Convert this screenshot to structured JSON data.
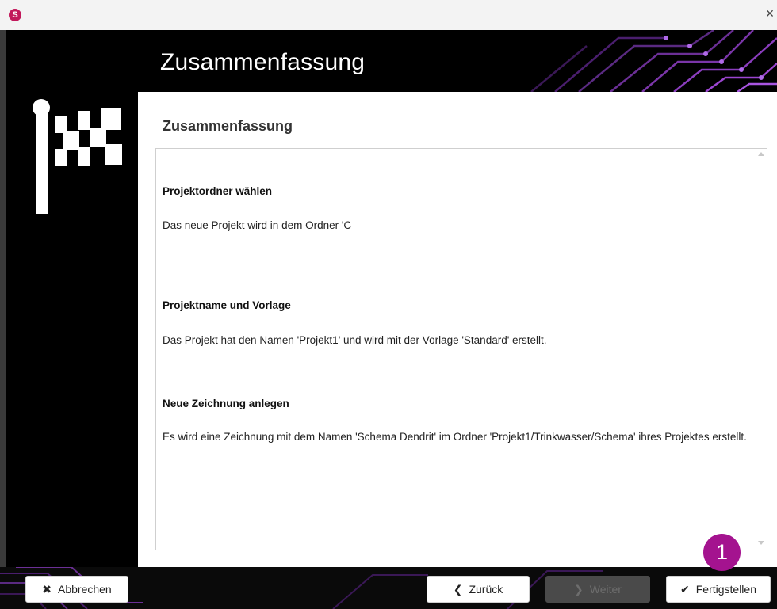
{
  "window": {
    "app_logo_letter": "S",
    "close_glyph": "×"
  },
  "header": {
    "title": "Zusammenfassung"
  },
  "main": {
    "title": "Zusammenfassung",
    "sections": [
      {
        "heading": "Projektordner wählen",
        "text": "Das neue Projekt wird in dem Ordner 'C"
      },
      {
        "heading": "Projektname und Vorlage",
        "text": "Das Projekt hat den Namen 'Projekt1' und wird mit der Vorlage 'Standard' erstellt."
      },
      {
        "heading": "Neue Zeichnung anlegen",
        "text": "Es wird eine Zeichnung mit dem Namen 'Schema Dendrit' im Ordner 'Projekt1/Trinkwasser/Schema' ihres Projektes erstellt."
      }
    ]
  },
  "footer": {
    "cancel_label": "Abbrechen",
    "cancel_icon": "✖",
    "back_label": "Zurück",
    "back_icon": "❮",
    "next_label": "Weiter",
    "next_icon": "❯",
    "finish_label": "Fertigstellen",
    "finish_icon": "✔"
  },
  "annotation": {
    "badge": "1"
  },
  "colors": {
    "accent": "#a4138f",
    "logo": "#c2185b"
  }
}
